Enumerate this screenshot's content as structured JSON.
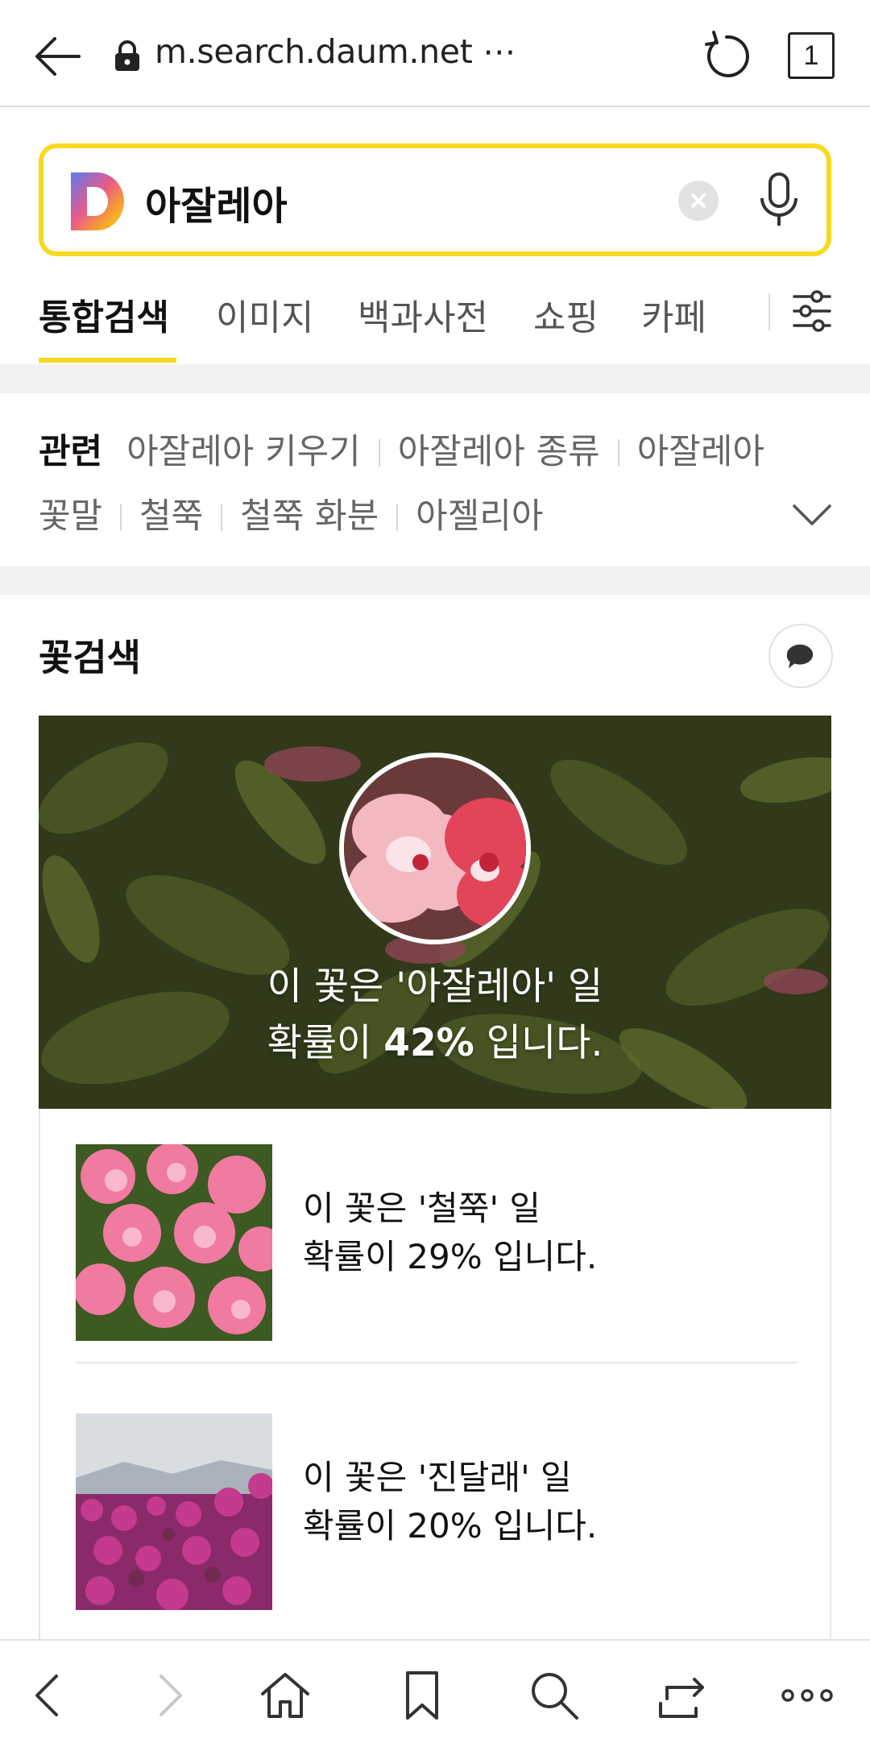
{
  "browser": {
    "url": "m.search.daum.net ⋯",
    "tab_count": "1"
  },
  "search": {
    "query": "아잘레아"
  },
  "tabs": [
    {
      "label": "통합검색"
    },
    {
      "label": "이미지"
    },
    {
      "label": "백과사전"
    },
    {
      "label": "쇼핑"
    },
    {
      "label": "카페"
    }
  ],
  "related": {
    "title": "관련",
    "items": [
      "아잘레아 키우기",
      "아잘레아 종류",
      "아잘레아 꽃말",
      "철쭉",
      "철쭉 화분",
      "아젤리아"
    ]
  },
  "flower_search": {
    "title": "꽃검색",
    "top_result": {
      "line1": "이 꽃은 '아잘레아' 일",
      "line2_prefix": "확률이 ",
      "probability": "42%",
      "line2_suffix": " 입니다."
    },
    "results": [
      {
        "line1": "이 꽃은 '철쭉' 일",
        "line2": "확률이 29% 입니다."
      },
      {
        "line1": "이 꽃은 '진달래' 일",
        "line2": "확률이 20% 입니다."
      }
    ]
  },
  "colors": {
    "accent": "#f7d91d",
    "tab_active": "#111111",
    "tab_inactive": "#555555"
  },
  "icons": [
    "back-arrow-icon",
    "lock-icon",
    "reload-icon",
    "daum-logo",
    "clear-icon",
    "mic-icon",
    "filter-icon",
    "chevron-down-icon",
    "comment-icon",
    "chevron-left-icon",
    "chevron-right-icon",
    "home-icon",
    "bookmark-icon",
    "search-icon",
    "share-icon",
    "more-icon"
  ]
}
